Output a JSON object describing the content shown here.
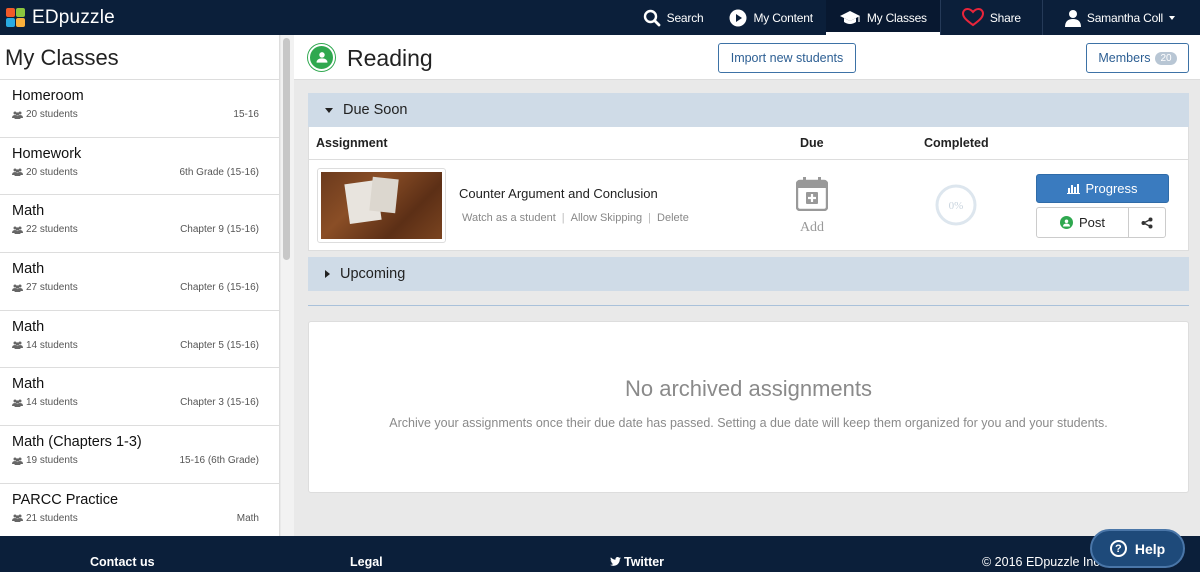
{
  "app": {
    "logo_text": "EDpuzzle"
  },
  "nav": {
    "search": "Search",
    "my_content": "My Content",
    "my_classes": "My Classes",
    "share": "Share",
    "user": "Samantha Coll"
  },
  "sidebar": {
    "title": "My Classes",
    "classes": [
      {
        "name": "Homeroom",
        "students": "20 students",
        "tag": "15-16"
      },
      {
        "name": "Homework",
        "students": "20 students",
        "tag": "6th Grade (15-16)"
      },
      {
        "name": "Math",
        "students": "22 students",
        "tag": "Chapter 9 (15-16)"
      },
      {
        "name": "Math",
        "students": "27 students",
        "tag": "Chapter 6 (15-16)"
      },
      {
        "name": "Math",
        "students": "14 students",
        "tag": "Chapter 5 (15-16)"
      },
      {
        "name": "Math",
        "students": "14 students",
        "tag": "Chapter 3 (15-16)"
      },
      {
        "name": "Math (Chapters 1-3)",
        "students": "19 students",
        "tag": "15-16 (6th Grade)"
      },
      {
        "name": "PARCC Practice",
        "students": "21 students",
        "tag": "Math"
      }
    ]
  },
  "header": {
    "class_title": "Reading",
    "import_button": "Import new students",
    "members_label": "Members",
    "members_count": "20"
  },
  "due_soon": {
    "title": "Due Soon",
    "columns": {
      "assignment": "Assignment",
      "due": "Due",
      "completed": "Completed"
    },
    "assignment": {
      "title": "Counter Argument and Conclusion",
      "link_watch": "Watch as a student",
      "link_skip": "Allow Skipping",
      "link_delete": "Delete",
      "due_label": "Add",
      "completed_percent": "0%",
      "progress_button": "Progress",
      "post_button": "Post"
    }
  },
  "upcoming": {
    "title": "Upcoming"
  },
  "archive": {
    "title": "No archived assignments",
    "description": "Archive your assignments once their due date has passed. Setting a due date will keep them organized for you and your students."
  },
  "footer": {
    "contact": "Contact us",
    "legal": "Legal",
    "twitter": "Twitter",
    "copyright": "© 2016 EDpuzzle Inc."
  },
  "help": {
    "label": "Help"
  },
  "colors": {
    "navy": "#0b1f3a",
    "accent_blue": "#3a7bbf",
    "panel_head": "#cfdbe7",
    "green": "#2fa84f"
  }
}
